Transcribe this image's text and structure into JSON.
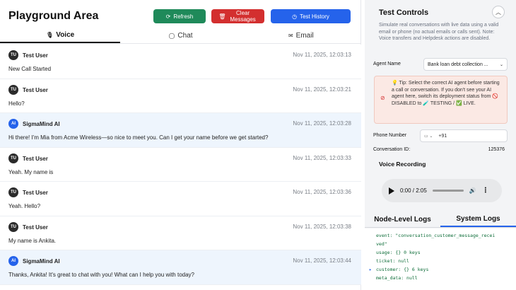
{
  "header": {
    "title": "Playground Area",
    "refresh_label": "Refresh",
    "clear_label": "Clear Messages",
    "history_label": "Test History"
  },
  "tabs": [
    {
      "label": "Voice",
      "icon": "microphone-icon",
      "active": true
    },
    {
      "label": "Chat",
      "icon": "chat-bubble-icon",
      "active": false
    },
    {
      "label": "Email",
      "icon": "mail-icon",
      "active": false
    }
  ],
  "messages": [
    {
      "initials": "TU",
      "sender": "Test User",
      "time": "Nov 11, 2025, 12:03:13",
      "text": "New Call Started",
      "type": "user"
    },
    {
      "initials": "TU",
      "sender": "Test User",
      "time": "Nov 11, 2025, 12:03:21",
      "text": "Hello?",
      "type": "user"
    },
    {
      "initials": "AI",
      "sender": "SigmaMind AI",
      "time": "Nov 11, 2025, 12:03:28",
      "text": "Hi there! I'm Mia from Acme Wireless—so nice to meet you. Can I get your name before we get started?",
      "type": "ai"
    },
    {
      "initials": "TU",
      "sender": "Test User",
      "time": "Nov 11, 2025, 12:03:33",
      "text": "Yeah. My name is",
      "type": "user"
    },
    {
      "initials": "TU",
      "sender": "Test User",
      "time": "Nov 11, 2025, 12:03:36",
      "text": "Yeah. Hello?",
      "type": "user"
    },
    {
      "initials": "TU",
      "sender": "Test User",
      "time": "Nov 11, 2025, 12:03:38",
      "text": "My name is Ankita.",
      "type": "user"
    },
    {
      "initials": "AI",
      "sender": "SigmaMind AI",
      "time": "Nov 11, 2025, 12:03:44",
      "text": "Thanks, Ankita! It's great to chat with you! What can I help you with today?",
      "type": "ai"
    }
  ],
  "controls": {
    "title": "Test Controls",
    "description": "Simulate real conversations with live data using a valid email or phone (no actual emails or calls sent). Note: Voice transfers and Helpdesk actions are disabled.",
    "agent_label": "Agent Name",
    "agent_value": "Bank loan debt collection ...",
    "tip": "💡 Tip: Select the correct AI agent before starting a call or conversation. If you don't see your AI agent here, switch its deployment status from 🚫 DISABLED to 🧪 TESTING / ✅ LIVE.",
    "phone_label": "Phone Number",
    "phone_value": "+91",
    "conv_label": "Conversation ID:",
    "conv_value": "125376",
    "voice_title": "Voice Recording",
    "audio_time": "0:00 / 2:05"
  },
  "logs": {
    "tab_node": "Node-Level Logs",
    "tab_system": "System Logs",
    "lines": [
      {
        "arrow": "",
        "text": "event: \"conversation_customer_message_recei"
      },
      {
        "arrow": "",
        "text": "ved\""
      },
      {
        "arrow": "",
        "text": "usage: {} 0 keys"
      },
      {
        "arrow": "",
        "text": "ticket: null"
      },
      {
        "arrow": "▸",
        "text": "customer: {} 6 keys"
      },
      {
        "arrow": "",
        "text": "meta_data: null"
      }
    ]
  },
  "colors": {
    "refresh": "#1f8a5a",
    "clear": "#d32f2f",
    "history": "#2563eb"
  }
}
